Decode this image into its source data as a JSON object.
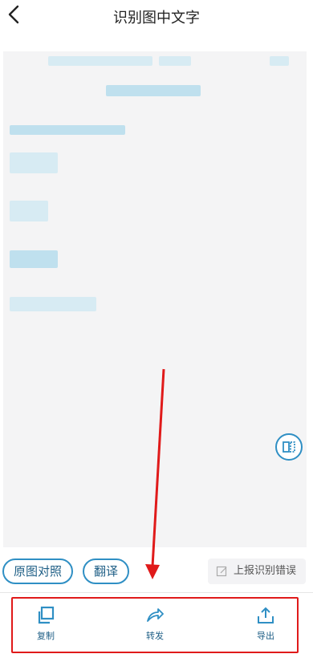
{
  "header": {
    "title": "识别图中文字"
  },
  "actions": {
    "compare_label": "原图对照",
    "translate_label": "翻译",
    "report_label": "上报识别错误"
  },
  "toolbar": {
    "copy_label": "复制",
    "forward_label": "转发",
    "export_label": "导出"
  },
  "colors": {
    "accent": "#2f8fc4",
    "highlight_frame": "#e01a1a",
    "annotation_arrow": "#e01a1a",
    "doc_background": "#f4f4f5"
  }
}
